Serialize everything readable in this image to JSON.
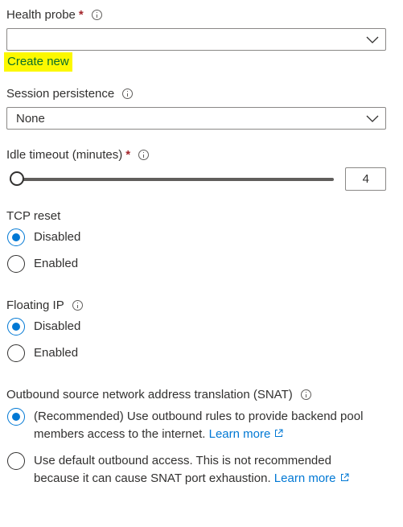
{
  "health_probe": {
    "label": "Health probe",
    "required_mark": "*",
    "value": "",
    "create_new": "Create new"
  },
  "session_persistence": {
    "label": "Session persistence",
    "value": "None"
  },
  "idle_timeout": {
    "label": "Idle timeout (minutes)",
    "required_mark": "*",
    "value": "4"
  },
  "tcp_reset": {
    "label": "TCP reset",
    "options": [
      "Disabled",
      "Enabled"
    ],
    "selected": "Disabled"
  },
  "floating_ip": {
    "label": "Floating IP",
    "options": [
      "Disabled",
      "Enabled"
    ],
    "selected": "Disabled"
  },
  "snat": {
    "label": "Outbound source network address translation (SNAT)",
    "option1_text": "(Recommended) Use outbound rules to provide backend pool members access to the internet.",
    "option1_link": "Learn more",
    "option2_text": "Use default outbound access. This is not recommended because it can cause SNAT port exhaustion.",
    "option2_link": "Learn more",
    "selected": 1
  },
  "colors": {
    "accent": "#0078d4",
    "highlight": "#fcf800",
    "required": "#a4262c"
  }
}
